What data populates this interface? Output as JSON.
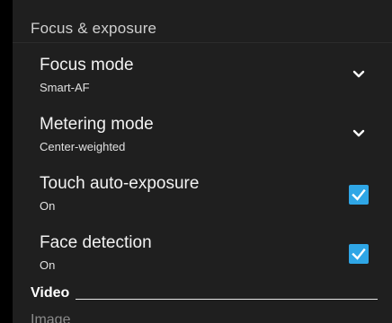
{
  "section_header": "Focus & exposure",
  "settings": [
    {
      "title": "Focus mode",
      "value": "Smart-AF",
      "control": "dropdown"
    },
    {
      "title": "Metering mode",
      "value": "Center-weighted",
      "control": "dropdown"
    },
    {
      "title": "Touch auto-exposure",
      "value": "On",
      "control": "checkbox",
      "checked": true
    },
    {
      "title": "Face detection",
      "value": "On",
      "control": "checkbox",
      "checked": true
    }
  ],
  "next_section": "Video",
  "partial_section": "Image",
  "colors": {
    "panel_bg": "#1f1f1f",
    "checkbox": "#2fa6e6",
    "text_primary": "#f2f2f2",
    "text_header": "#cfcfcf"
  },
  "icons": {
    "dropdown": "chevron-down-icon",
    "checkbox": "checkmark-icon"
  }
}
